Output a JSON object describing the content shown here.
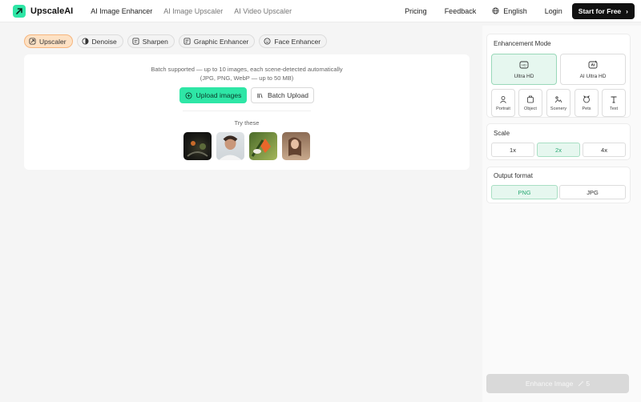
{
  "brand": {
    "name": "UpscaleAI",
    "accent": "#2ee6a6"
  },
  "nav": {
    "items": [
      "AI Image Enhancer",
      "AI Image Upscaler",
      "AI Video Upscaler"
    ],
    "active_index": 0
  },
  "header_right": {
    "pricing": "Pricing",
    "feedback": "Feedback",
    "language": "English",
    "login": "Login",
    "start": "Start for Free",
    "start_arrow": "›"
  },
  "tool_tabs": [
    {
      "label": "Upscaler",
      "icon": "upscale-icon",
      "active": true
    },
    {
      "label": "Denoise",
      "icon": "denoise-icon",
      "active": false
    },
    {
      "label": "Sharpen",
      "icon": "sharpen-icon",
      "active": false
    },
    {
      "label": "Graphic Enhancer",
      "icon": "graphic-icon",
      "active": false
    },
    {
      "label": "Face Enhancer",
      "icon": "face-icon",
      "active": false
    }
  ],
  "upload": {
    "desc_line1": "Batch supported — up to 10 images, each scene-detected automatically",
    "desc_line2": "(JPG, PNG, WebP — up to 50 MB)",
    "upload_label": "Upload images",
    "batch_label": "Batch Upload",
    "try_label": "Try these"
  },
  "panel": {
    "mode_title": "Enhancement Mode",
    "modes": [
      {
        "label": "Ultra HD",
        "icon": "hd-icon",
        "active": true
      },
      {
        "label": "AI Ultra HD",
        "icon": "ai-hd-icon",
        "active": false
      }
    ],
    "scenes": [
      {
        "label": "Portrait",
        "icon": "portrait-icon"
      },
      {
        "label": "Object",
        "icon": "object-icon"
      },
      {
        "label": "Scenery",
        "icon": "scenery-icon"
      },
      {
        "label": "Pets",
        "icon": "pets-icon"
      },
      {
        "label": "Text",
        "icon": "text-icon"
      }
    ],
    "scale_title": "Scale",
    "scales": [
      {
        "label": "1x",
        "active": false
      },
      {
        "label": "2x",
        "active": true
      },
      {
        "label": "4x",
        "active": false
      }
    ],
    "format_title": "Output format",
    "formats": [
      {
        "label": "PNG",
        "active": true
      },
      {
        "label": "JPG",
        "active": false
      }
    ],
    "enhance_label": "Enhance Image",
    "enhance_cost": "5"
  }
}
